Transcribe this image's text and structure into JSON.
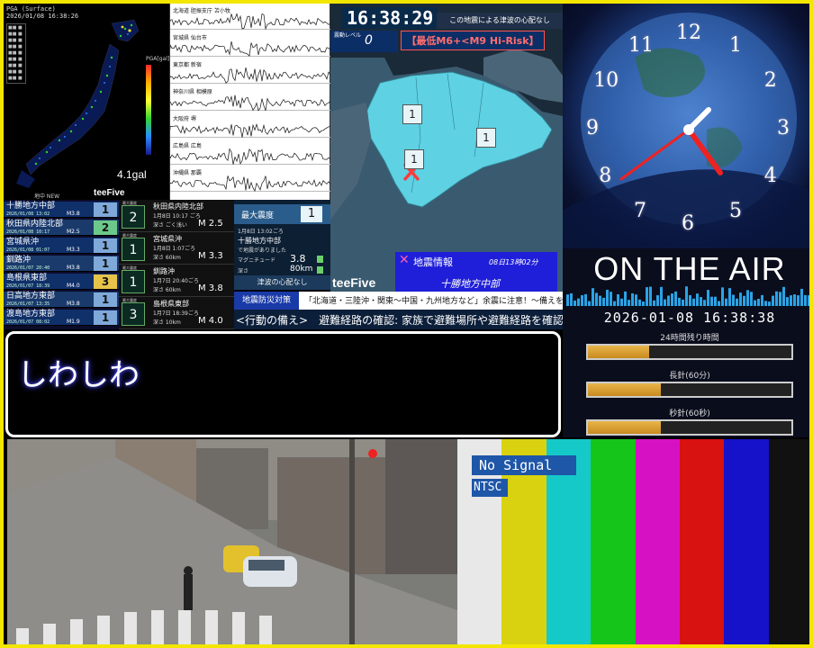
{
  "seismic": {
    "header_line1": "PGA (Surface)",
    "header_line2": "2026/01/08 16:38:26",
    "scale_label": "PGA[gal]",
    "max_gal": "4.1gal",
    "small_label": "地中 NEW",
    "logo": "teeFive"
  },
  "waveform": {
    "stations": [
      "北海道 胆振支庁 苫小牧",
      "宮城県 仙台市",
      "東京都 新宿",
      "神奈川県 相模原",
      "大阪府 堺",
      "広島県 広島",
      "沖縄県 那覇"
    ]
  },
  "map": {
    "clock": "16:38:29",
    "advisory": "この地震による津波の心配なし",
    "level_label": "震動レベル",
    "level_value": "0",
    "risk": "【最低M6+<M9 Hi-Risk】",
    "badges": [
      "1",
      "1",
      "1"
    ],
    "quake_title": "地震情報",
    "quake_time": "08日13時02分",
    "quake_region": "十勝地方中部",
    "logo": "teeFive"
  },
  "quake_list": [
    {
      "name": "十勝地方中部",
      "date": "2026/01/08 13:02",
      "mag": "M3.8",
      "level": "1",
      "color": "#7fa9d9"
    },
    {
      "name": "秋田県内陸北部",
      "date": "2026/01/08 10:17",
      "mag": "M2.5",
      "level": "2",
      "color": "#6cc98a"
    },
    {
      "name": "宮城県沖",
      "date": "2026/01/08 01:07",
      "mag": "M3.3",
      "level": "1",
      "color": "#7fa9d9"
    },
    {
      "name": "釧路沖",
      "date": "2026/01/07 20:40",
      "mag": "M3.8",
      "level": "1",
      "color": "#7fa9d9"
    },
    {
      "name": "島根県東部",
      "date": "2026/01/07 18:39",
      "mag": "M4.0",
      "level": "3",
      "color": "#e8c34a"
    },
    {
      "name": "日高地方東部",
      "date": "2026/01/07 13:35",
      "mag": "M3.8",
      "level": "1",
      "color": "#7fa9d9"
    },
    {
      "name": "渡島地方東部",
      "date": "2026/01/07 08:02",
      "mag": "M1.9",
      "level": "1",
      "color": "#7fa9d9"
    }
  ],
  "detail": [
    {
      "lt": "最大震度",
      "lv": "2",
      "name": "秋田県内陸北部",
      "date": "1月8日 10:17 ごろ",
      "depth": "深さ ごく浅い",
      "mag": "M 2.5"
    },
    {
      "lt": "最大震度",
      "lv": "1",
      "name": "宮城県沖",
      "date": "1月8日 1:07ごろ",
      "depth": "深さ 60km",
      "mag": "M 3.3"
    },
    {
      "lt": "最大震度",
      "lv": "1",
      "name": "釧路沖",
      "date": "1月7日 20:40ごろ",
      "depth": "深さ 60km",
      "mag": "M 3.8"
    },
    {
      "lt": "最大震度",
      "lv": "3",
      "name": "島根県東部",
      "date": "1月7日 18:39ごろ",
      "depth": "深さ 10km",
      "mag": "M 4.0"
    }
  ],
  "max_intensity": {
    "label": "最大震度",
    "value": "1",
    "time": "1月8日 13:02ごろ",
    "region": "十勝地方中部",
    "region_note": "で地震がありました",
    "mag_label": "マグニチュード",
    "mag_value": "3.8",
    "depth_label": "深さ",
    "depth_value": "80km",
    "tsunami": "津波の心配なし"
  },
  "alert": {
    "tag": "地震防災対策",
    "msg": "「北海道・三陸沖・関東～中国・九州地方など」余震に注意！～備えを～",
    "action": "<行動の備え>　避難経路の確認: 家族で避難場所や避難経路を確認し"
  },
  "clock_panel": {
    "numbers": [
      "12",
      "1",
      "2",
      "3",
      "4",
      "5",
      "6",
      "7",
      "8",
      "9",
      "10",
      "11"
    ]
  },
  "on_air": {
    "title": "ON THE AIR",
    "datetime": "2026-01-08 16:38:38",
    "bars": [
      {
        "label": "24時間残り時間",
        "progress": 0.3
      },
      {
        "label": "長針(60分)",
        "progress": 0.36
      },
      {
        "label": "秒針(60秒)",
        "progress": 0.36
      }
    ]
  },
  "subtitle": {
    "text": "しわしわ"
  },
  "color_bars": {
    "no_signal": "No Signal",
    "standard": "NTSC",
    "colors": [
      "#e8e8e8",
      "#d9d211",
      "#16c9c9",
      "#16c51a",
      "#d611c4",
      "#d81111",
      "#1512c9",
      "#111111"
    ]
  }
}
